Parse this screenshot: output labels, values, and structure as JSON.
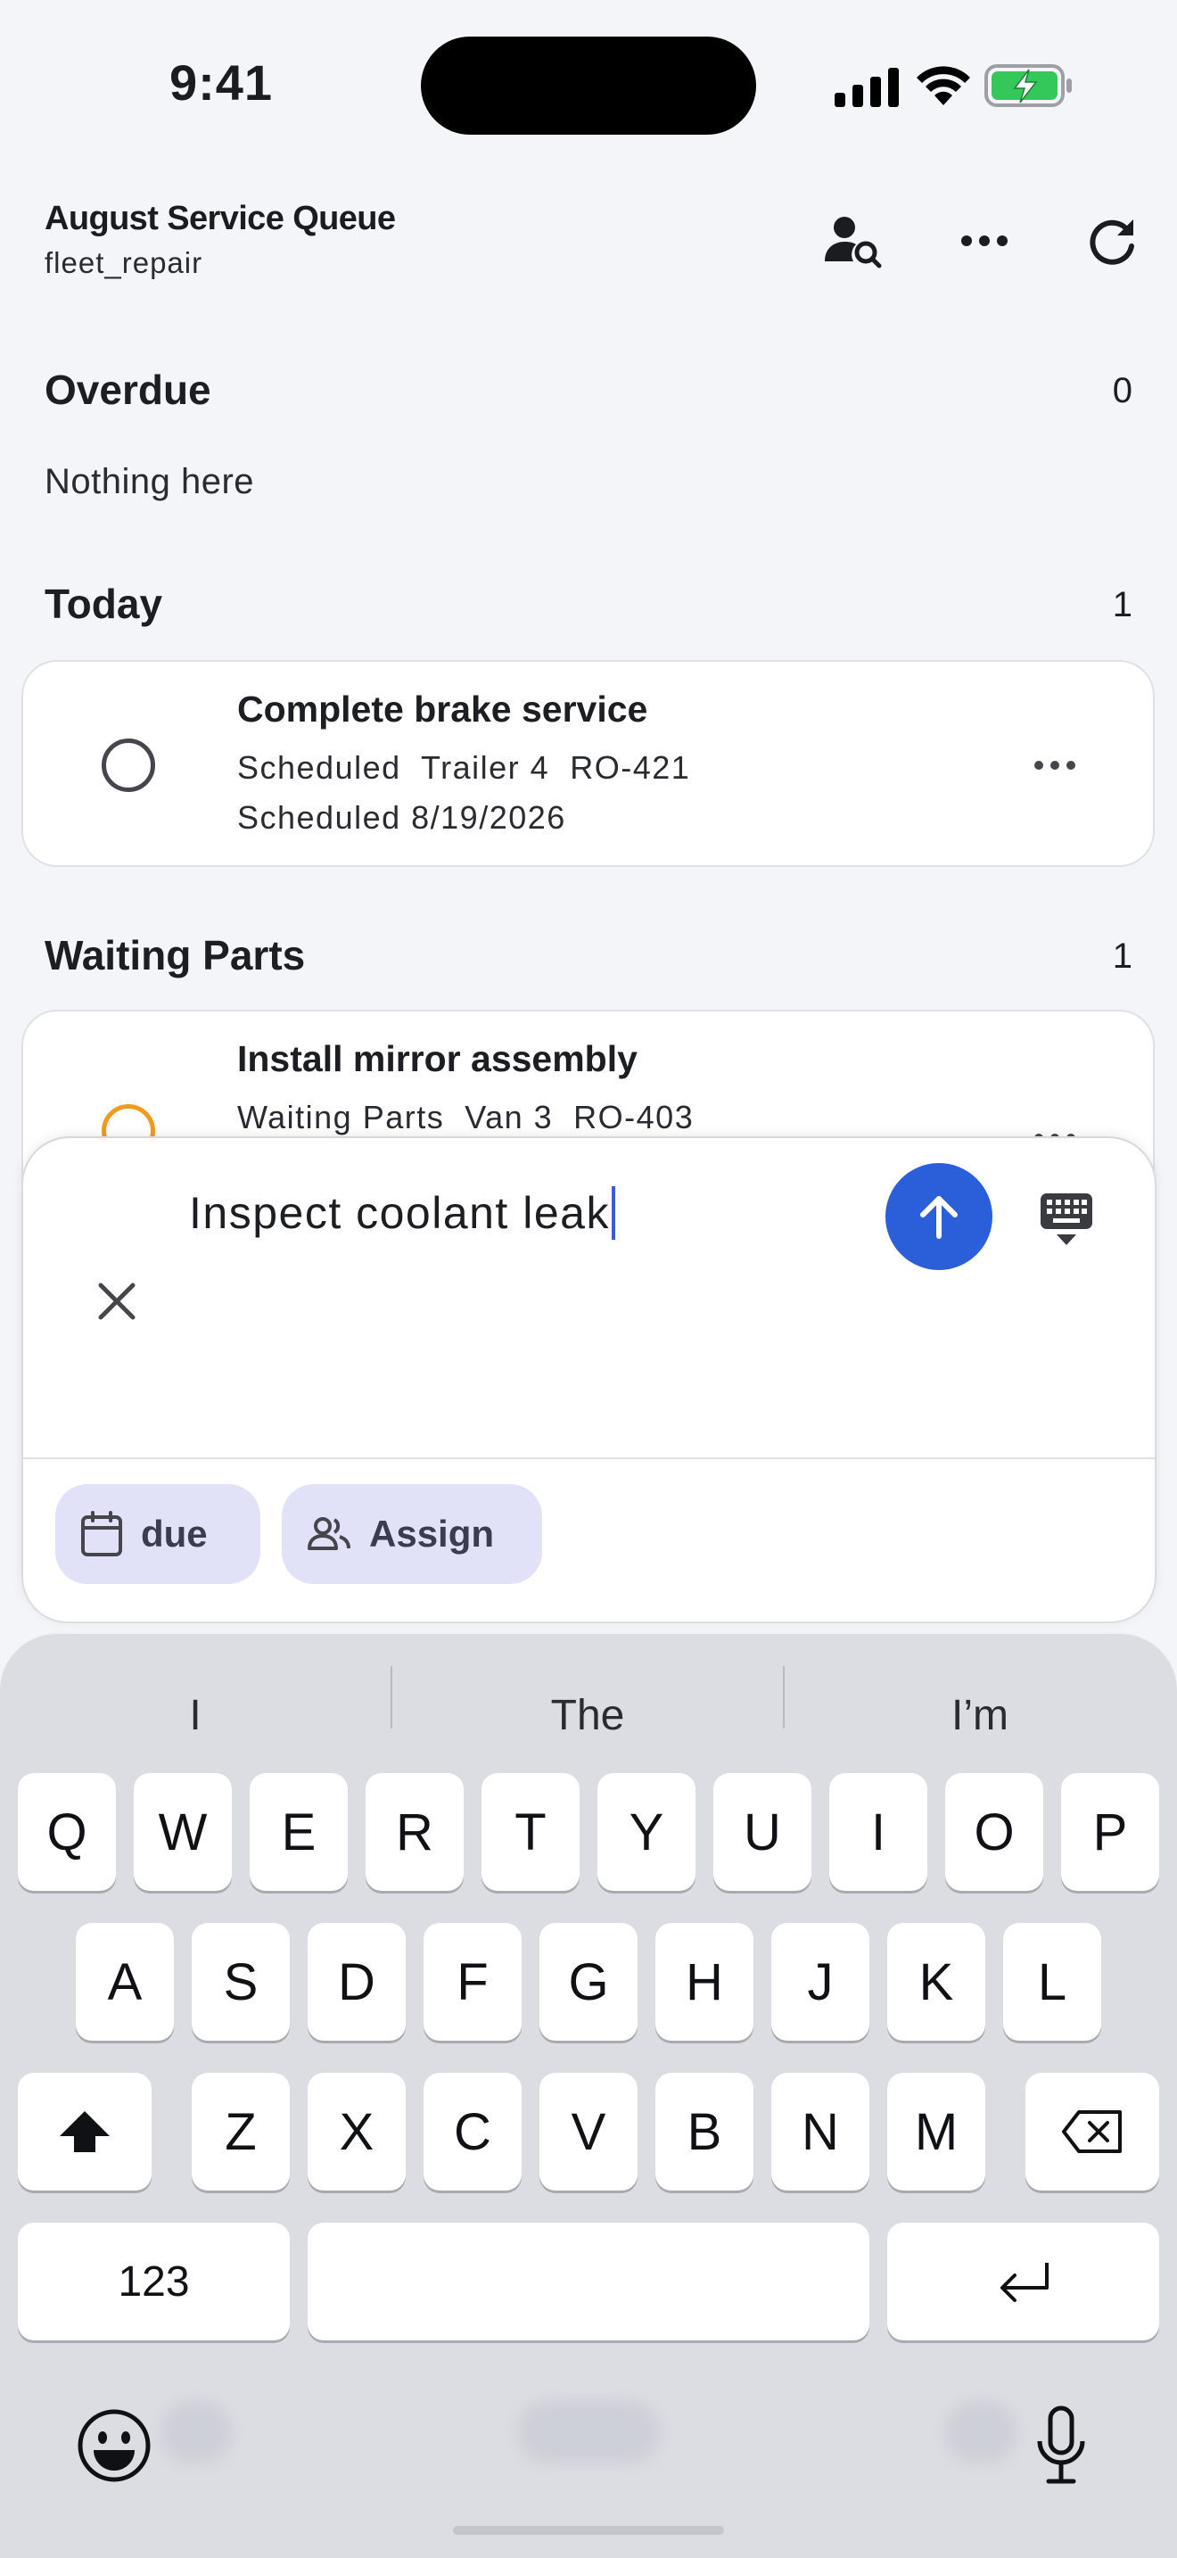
{
  "status_bar": {
    "time": "9:41"
  },
  "header": {
    "title": "August Service Queue",
    "subtitle": "fleet_repair",
    "find_assignee_icon": "person-search-icon",
    "more_icon": "more-horizontal-icon",
    "refresh_icon": "refresh-icon"
  },
  "sections": {
    "overdue": {
      "title": "Overdue",
      "count": "0",
      "empty_text": "Nothing here"
    },
    "today": {
      "title": "Today",
      "count": "1"
    },
    "waiting": {
      "title": "Waiting Parts",
      "count": "1"
    }
  },
  "tasks": [
    {
      "title": "Complete brake service",
      "status": "Scheduled",
      "vehicle": "Trailer 4",
      "order": "RO-421",
      "date": "Scheduled 8/19/2026"
    },
    {
      "title": "Install mirror assembly",
      "status": "Waiting Parts",
      "vehicle": "Van 3",
      "order": "RO-403"
    }
  ],
  "composer": {
    "input_value": "Inspect coolant leak",
    "chips": {
      "due": "due",
      "assign": "Assign"
    }
  },
  "keyboard": {
    "suggestions": [
      "I",
      "The",
      "I’m"
    ],
    "row1": [
      "Q",
      "W",
      "E",
      "R",
      "T",
      "Y",
      "U",
      "I",
      "O",
      "P"
    ],
    "row2": [
      "A",
      "S",
      "D",
      "F",
      "G",
      "H",
      "J",
      "K",
      "L"
    ],
    "row3": [
      "Z",
      "X",
      "C",
      "V",
      "B",
      "N",
      "M"
    ],
    "numbers_label": "123"
  },
  "colors": {
    "accent": "#2b5fd9",
    "paused": "#f19a1f",
    "chip_bg": "#e1e2f8",
    "battery": "#34c759"
  }
}
